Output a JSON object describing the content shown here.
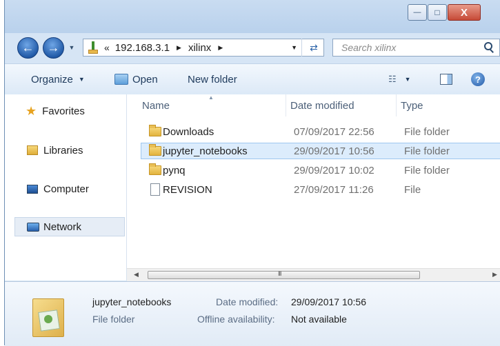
{
  "titlebar": {
    "buttons": [
      "—",
      "□",
      "X"
    ]
  },
  "address": {
    "overflow": "«",
    "crumbs": [
      "192.168.3.1",
      "xilinx"
    ],
    "search_placeholder": "Search xilinx"
  },
  "toolbar": {
    "organize": "Organize",
    "open": "Open",
    "new_folder": "New folder"
  },
  "nav": {
    "items": [
      {
        "label": "Favorites",
        "icon": "star-icon"
      },
      {
        "label": "Libraries",
        "icon": "libraries-icon"
      },
      {
        "label": "Computer",
        "icon": "computer-icon"
      },
      {
        "label": "Network",
        "icon": "network-icon"
      }
    ]
  },
  "columns": {
    "name": "Name",
    "date": "Date modified",
    "type": "Type"
  },
  "files": [
    {
      "name": "Downloads",
      "date": "07/09/2017 22:56",
      "type": "File folder",
      "kind": "folder"
    },
    {
      "name": "jupyter_notebooks",
      "date": "29/09/2017 10:56",
      "type": "File folder",
      "kind": "folder",
      "selected": true
    },
    {
      "name": "pynq",
      "date": "29/09/2017 10:02",
      "type": "File folder",
      "kind": "folder"
    },
    {
      "name": "REVISION",
      "date": "27/09/2017 11:26",
      "type": "File",
      "kind": "file"
    }
  ],
  "scrollbar": {
    "thumb_grip": "III"
  },
  "details": {
    "name": "jupyter_notebooks",
    "type": "File folder",
    "date_label": "Date modified:",
    "date_value": "29/09/2017 10:56",
    "offline_label": "Offline availability:",
    "offline_value": "Not available"
  }
}
